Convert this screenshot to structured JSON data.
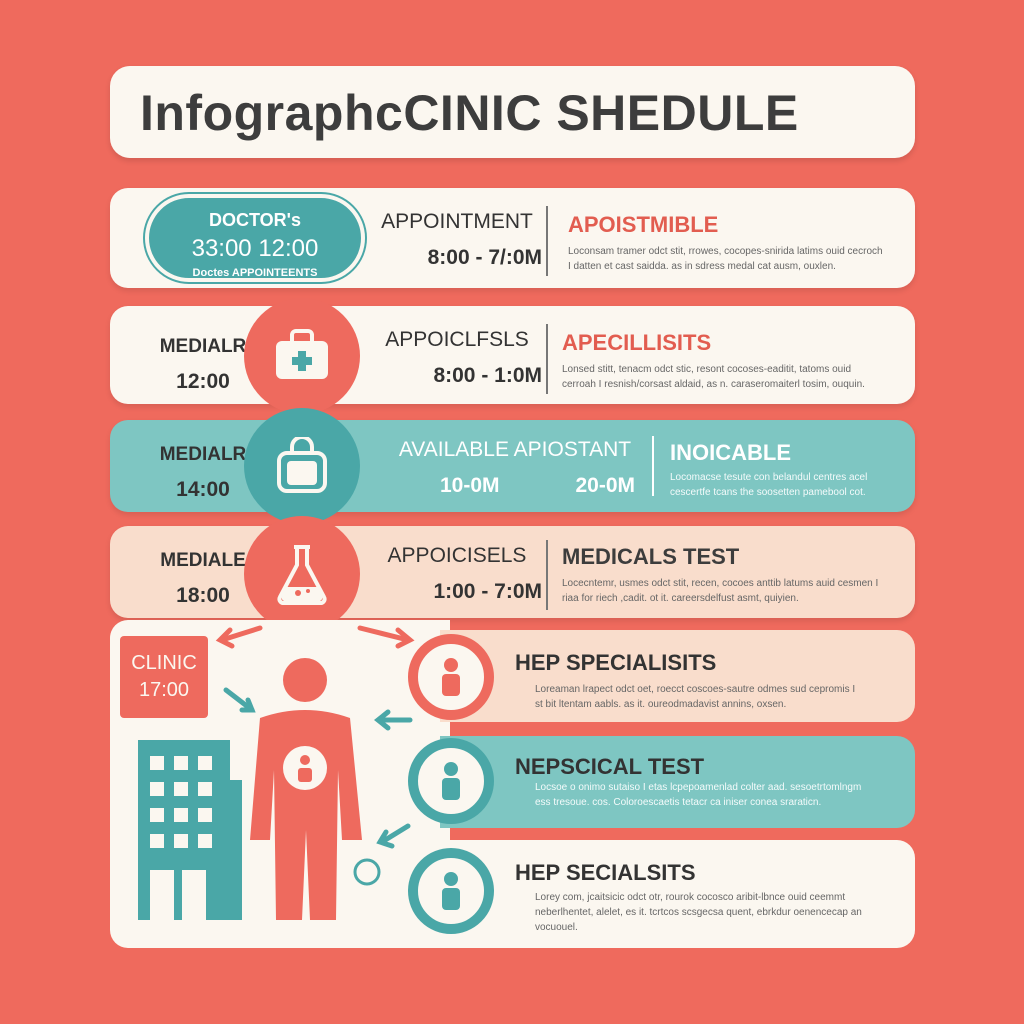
{
  "title": "InfographcCINIC SHEDULE",
  "colors": {
    "background": "#ef6a5d",
    "cream": "#fbf7f0",
    "teal": "#4aa7a7",
    "light_teal": "#7ec6c2",
    "peach": "#f9ddcc",
    "red": "#ee6a5e"
  },
  "rows": [
    {
      "badge": {
        "line1": "DOCTOR's",
        "line2": "33:00 12:00",
        "line3": "Doctes APPOINTEENTS"
      },
      "mid_title": "APPOINTMENT",
      "mid_time": "8:00 - 7/:0M",
      "right_title": "APOISTMIBLE",
      "right_text": "Loconsam tramer odct stit, rrowes, cocopes-snirida latims ouid cecroch I datten et cast saidda. as in sdress medal cat ausm, ouxlen."
    },
    {
      "left_label": "MEDIALR",
      "left_time": "12:00",
      "icon": "medical-bag-icon",
      "mid_title": "APPOICLFSLS",
      "mid_time": "8:00 - 1:0M",
      "right_title": "APECILLISITS",
      "right_text": "Lonsed stitt, tenacm odct stic, resont cocoses-eaditit, tatoms ouid cerroah I resnish/corsast aldaid, as n. caraseromaiterl tosim, ouquin."
    },
    {
      "left_label": "MEDIALR",
      "left_time": "14:00",
      "icon": "bag-icon",
      "mid_title": "AVAILABLE APIOSTANT",
      "mid_time_a": "10-0M",
      "mid_time_b": "20-0M",
      "right_title": "INOICABLE",
      "right_text": "Locomacse tesute con belandul centres acel cescertfe tcans the soosetten pamebool cot."
    },
    {
      "left_label": "MEDIALE",
      "left_time": "18:00",
      "icon": "flask-icon",
      "mid_title": "APPOICISELS",
      "mid_time": "1:00 - 7:0M",
      "right_title": "MEDICALS TEST",
      "right_text": "Locecntemr, usmes odct stit, recen, cocoes anttib latums auid cesmen I riaa for riech ,cadit. ot it. careersdelfust asmt, quiyien."
    }
  ],
  "clinic_sign": {
    "label": "CLINIC",
    "time": "17:00"
  },
  "bottom_rows": [
    {
      "title": "HEP SPECIALISITS",
      "text": "Loreaman lrapect odct oet, roecct coscoes-sautre odmes sud cepromis I st bit ltentam aabls. as it. oureodmadavist annins, oxsen."
    },
    {
      "title": "NEPSCICAL TEST",
      "text": "Locsoe o onimo sutaiso I etas lcpepoamenlad colter aad. sesoetrtomlngm ess tresoue. cos. Coloroescaetis tetacr ca iniser conea sraraticn."
    },
    {
      "title": "HEP SECIALSITS",
      "text": "Lorey com, jcaitsicic odct otr, rourok cocosco aribit-lbnce ouid ceemmt neberlhentet, alelet, es it. tcrtcos scsgecsa quent, ebrkdur oenencecap an vocuouel."
    }
  ]
}
